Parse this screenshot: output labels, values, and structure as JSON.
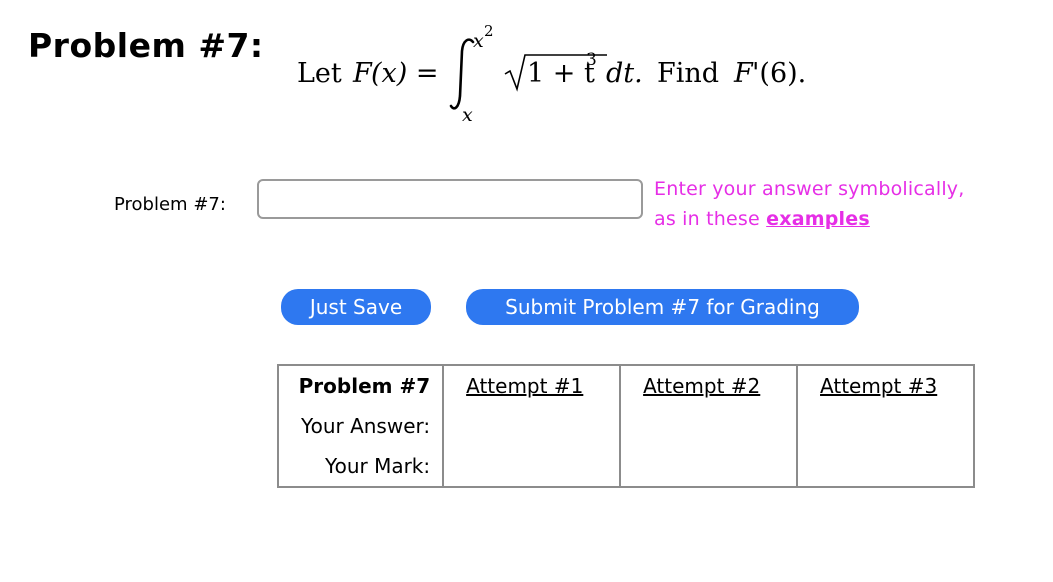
{
  "problem": {
    "title": "Problem #7:",
    "statement": {
      "let": "Let",
      "fname": "F",
      "fargs": "(x) =",
      "upper": "x",
      "upper_exp": "2",
      "lower": "x",
      "radicand": "1 + t",
      "radicand_exp": "3",
      "dt": "dt.",
      "find": "Find",
      "target": "F",
      "target_rest": "'(6)."
    }
  },
  "answer": {
    "label": "Problem #7:",
    "value": "",
    "hint_line1": "Enter your answer symbolically,",
    "hint_line2": "as in these",
    "hint_link": "examples"
  },
  "buttons": {
    "save": "Just Save",
    "submit": "Submit Problem #7 for Grading"
  },
  "attempts_table": {
    "header": "Problem #7",
    "attempts": [
      "Attempt #1",
      "Attempt #2",
      "Attempt #3"
    ],
    "rows": [
      "Your Answer:",
      "Your Mark:"
    ]
  }
}
